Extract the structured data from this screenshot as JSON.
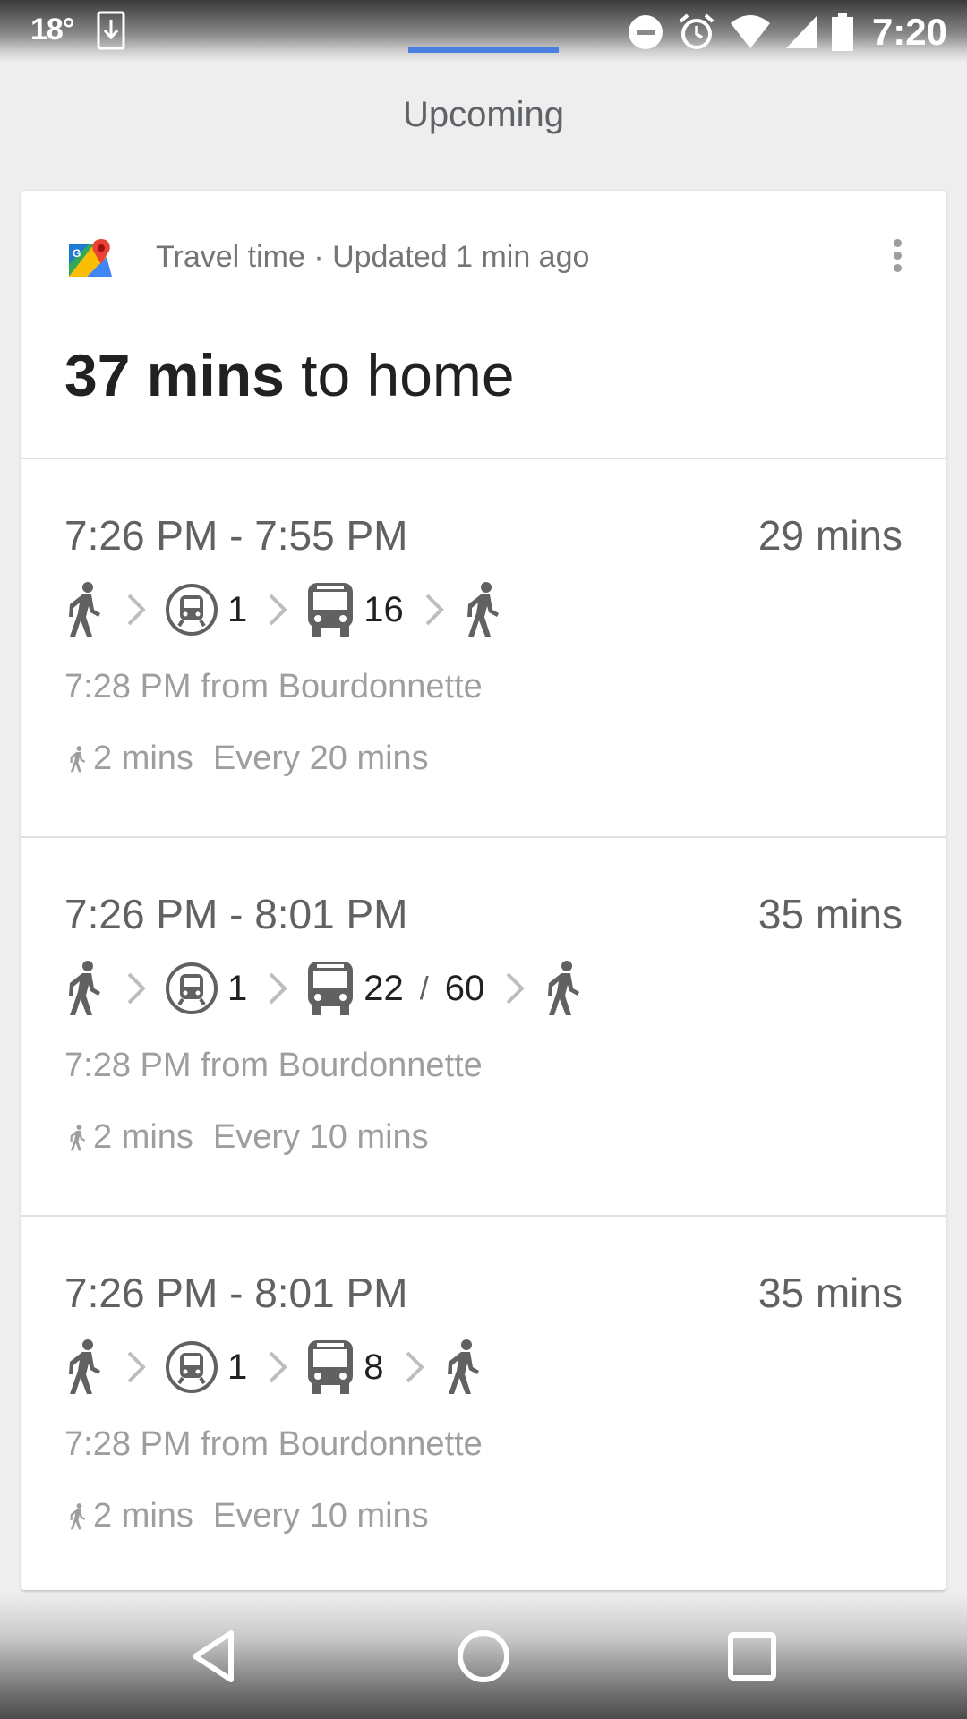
{
  "status_bar": {
    "temperature": "18°",
    "time": "7:20",
    "icons": [
      "download-icon",
      "dnd-icon",
      "alarm-icon",
      "wifi-icon",
      "signal-icon",
      "battery-icon"
    ]
  },
  "section_title": "Upcoming",
  "card": {
    "meta": "Travel time · Updated 1 min ago",
    "headline_bold": "37 mins",
    "headline_rest": " to home",
    "routes": [
      {
        "times": "7:26 PM - 7:55 PM",
        "duration": "29 mins",
        "metro_line": "1",
        "bus_lines": [
          "16"
        ],
        "from": "7:28 PM from Bourdonnette",
        "walk": "2 mins",
        "frequency": "Every 20 mins"
      },
      {
        "times": "7:26 PM - 8:01 PM",
        "duration": "35 mins",
        "metro_line": "1",
        "bus_lines": [
          "22",
          "60"
        ],
        "bus_separator": "/",
        "from": "7:28 PM from Bourdonnette",
        "walk": "2 mins",
        "frequency": "Every 10 mins"
      },
      {
        "times": "7:26 PM - 8:01 PM",
        "duration": "35 mins",
        "metro_line": "1",
        "bus_lines": [
          "8"
        ],
        "from": "7:28 PM from Bourdonnette",
        "walk": "2 mins",
        "frequency": "Every 10 mins"
      }
    ]
  },
  "nav": {
    "buttons": [
      "back-button",
      "home-button",
      "recents-button"
    ]
  },
  "colors": {
    "accent": "#4a7fe0",
    "icon_gray": "#616161",
    "secondary_text": "#9e9e9e"
  }
}
